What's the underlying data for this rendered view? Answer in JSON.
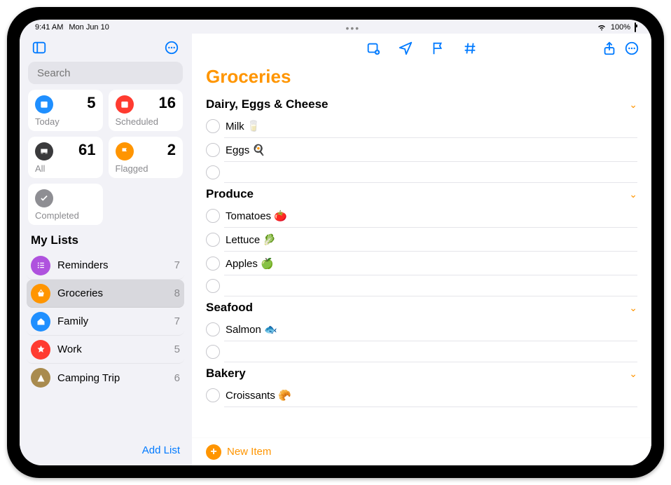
{
  "status": {
    "time": "9:41 AM",
    "date": "Mon Jun 10",
    "battery_pct": "100%",
    "center_dots": "•••"
  },
  "sidebar": {
    "search_placeholder": "Search",
    "cards": {
      "today": {
        "label": "Today",
        "count": "5"
      },
      "scheduled": {
        "label": "Scheduled",
        "count": "16"
      },
      "all": {
        "label": "All",
        "count": "61"
      },
      "flagged": {
        "label": "Flagged",
        "count": "2"
      },
      "completed": {
        "label": "Completed",
        "count": ""
      }
    },
    "section_title": "My Lists",
    "lists": [
      {
        "name": "Reminders",
        "count": "7"
      },
      {
        "name": "Groceries",
        "count": "8"
      },
      {
        "name": "Family",
        "count": "7"
      },
      {
        "name": "Work",
        "count": "5"
      },
      {
        "name": "Camping Trip",
        "count": "6"
      }
    ],
    "add_list_label": "Add List"
  },
  "main": {
    "title": "Groceries",
    "groups": [
      {
        "title": "Dairy, Eggs & Cheese",
        "items": [
          "Milk 🥛",
          "Eggs 🍳"
        ],
        "trailing_empty": true
      },
      {
        "title": "Produce",
        "items": [
          "Tomatoes 🍅",
          "Lettuce 🥬",
          "Apples 🍏"
        ],
        "trailing_empty": true
      },
      {
        "title": "Seafood",
        "items": [
          "Salmon 🐟"
        ],
        "trailing_empty": true
      },
      {
        "title": "Bakery",
        "items": [
          "Croissants 🥐"
        ],
        "trailing_empty": false
      }
    ],
    "new_item_label": "New Item"
  }
}
